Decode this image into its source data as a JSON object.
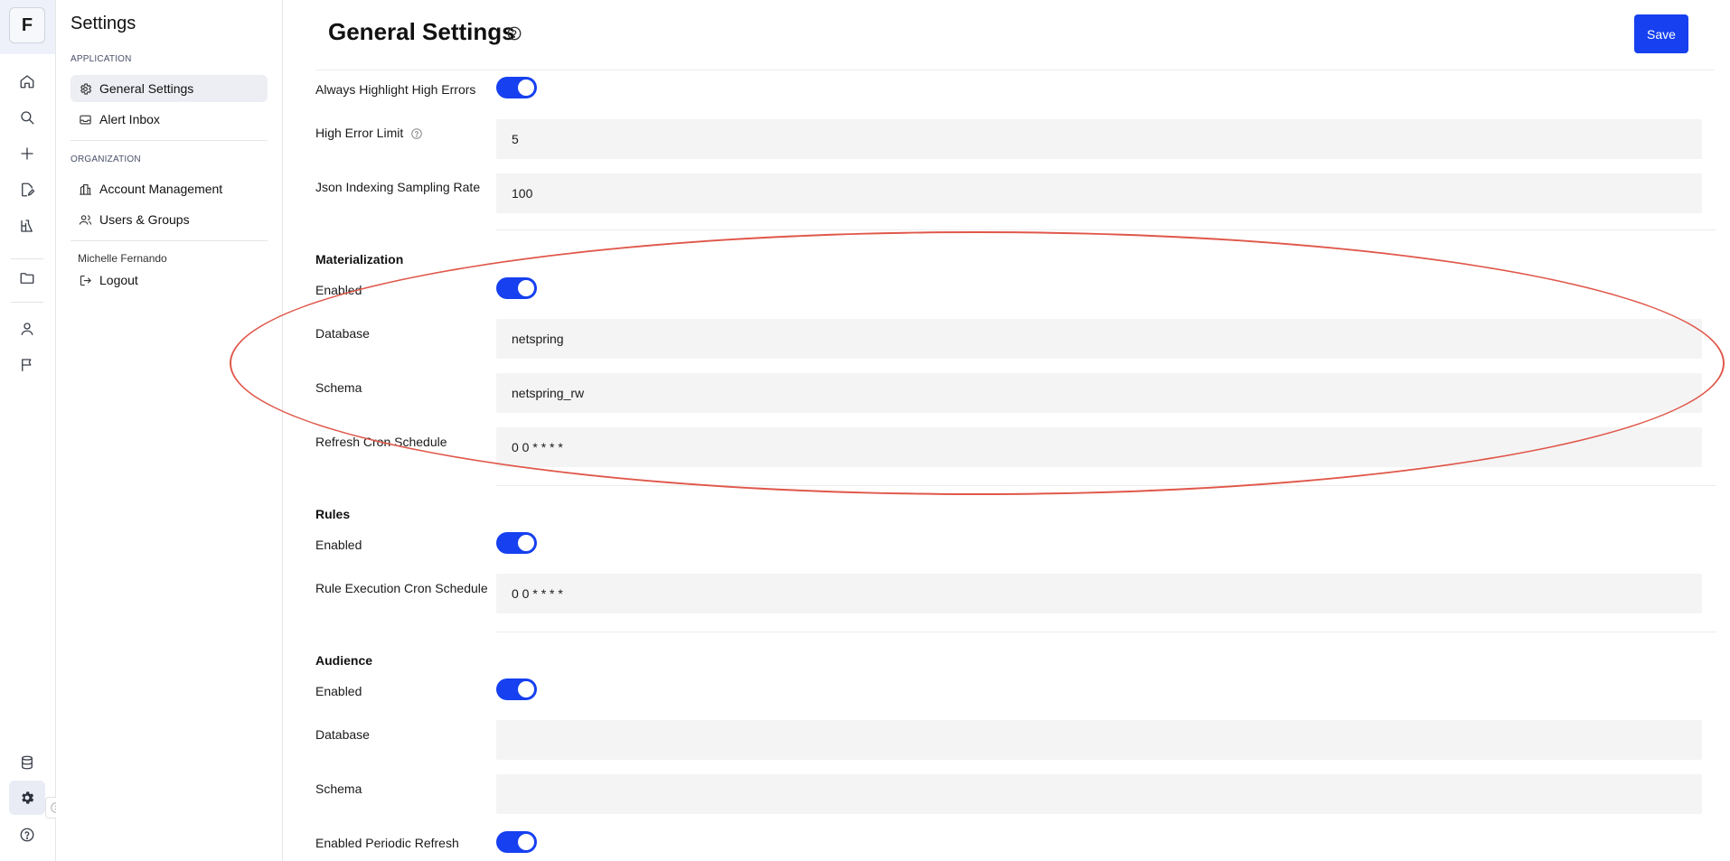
{
  "rail": {
    "logo_letter": "F",
    "icons": [
      "home-icon",
      "search-icon",
      "plus-icon",
      "edit-document-icon",
      "flask-icon",
      "folder-icon",
      "user-icon",
      "flag-icon",
      "database-icon",
      "gear-icon",
      "help-icon"
    ]
  },
  "sidebar": {
    "title": "Settings",
    "sections": [
      {
        "label": "APPLICATION",
        "items": [
          {
            "label": "General Settings",
            "icon": "gear-icon",
            "active": true
          },
          {
            "label": "Alert Inbox",
            "icon": "inbox-icon",
            "active": false
          }
        ]
      },
      {
        "label": "ORGANIZATION",
        "items": [
          {
            "label": "Account Management",
            "icon": "building-icon",
            "active": false
          },
          {
            "label": "Users & Groups",
            "icon": "users-icon",
            "active": false
          }
        ]
      }
    ],
    "user_name": "Michelle Fernando",
    "logout_label": "Logout"
  },
  "header": {
    "title": "General Settings",
    "save_label": "Save"
  },
  "errors": {
    "always_highlight_label": "Always Highlight High Errors",
    "always_highlight_on": true,
    "high_error_limit_label": "High Error Limit",
    "high_error_limit_value": "5",
    "json_indexing_label": "Json Indexing Sampling Rate",
    "json_indexing_value": "100"
  },
  "materialization": {
    "heading": "Materialization",
    "enabled_label": "Enabled",
    "enabled_on": true,
    "database_label": "Database",
    "database_value": "netspring",
    "schema_label": "Schema",
    "schema_value": "netspring_rw",
    "cron_label": "Refresh Cron Schedule",
    "cron_value": "0 0 * * * *"
  },
  "rules": {
    "heading": "Rules",
    "enabled_label": "Enabled",
    "enabled_on": true,
    "cron_label": "Rule Execution Cron Schedule",
    "cron_value": "0 0 * * * *"
  },
  "audience": {
    "heading": "Audience",
    "enabled_label": "Enabled",
    "enabled_on": true,
    "database_label": "Database",
    "database_value": "",
    "schema_label": "Schema",
    "schema_value": "",
    "periodic_refresh_label": "Enabled Periodic Refresh",
    "periodic_refresh_on": true
  },
  "colors": {
    "accent": "#1640f0",
    "highlight_ring": "#e0574a",
    "field_bg": "#f4f4f4"
  }
}
